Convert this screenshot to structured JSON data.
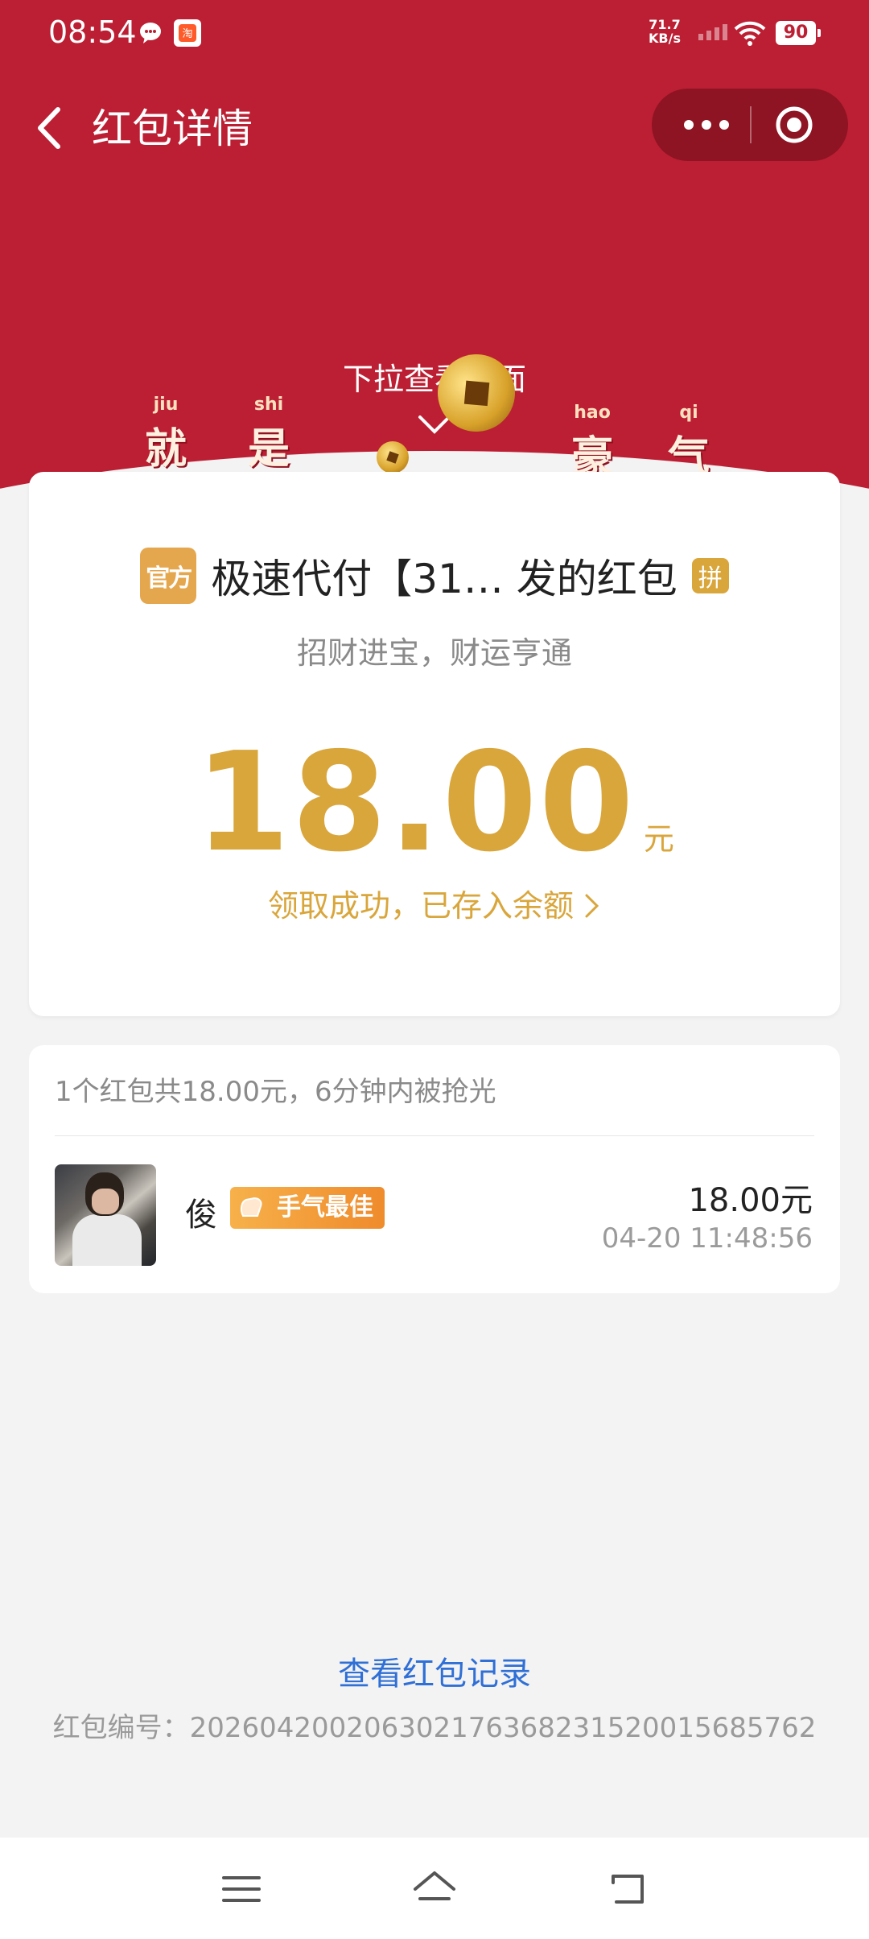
{
  "status_bar": {
    "time": "08:54",
    "net_speed_value": "71.7",
    "net_speed_unit": "KB/s",
    "battery": "90",
    "icons": [
      "chat-bubble-icon",
      "taobao-app-icon",
      "signal-icon",
      "wifi-icon",
      "battery-icon"
    ]
  },
  "nav": {
    "title": "红包详情",
    "back_icon": "chevron-left-icon",
    "more_icon": "more-dots-icon",
    "close_icon": "target-close-icon"
  },
  "cover": {
    "pull_hint": "下拉查看封面",
    "characters": [
      {
        "pinyin": "jiu",
        "hanzi": "就"
      },
      {
        "pinyin": "shi",
        "hanzi": "是"
      },
      {
        "pinyin": "hao",
        "hanzi": "豪"
      },
      {
        "pinyin": "qi",
        "hanzi": "气"
      }
    ]
  },
  "packet": {
    "official_badge": "官方",
    "sender": "极速代付【31… 发的红包",
    "pin_badge": "拼",
    "greeting": "招财进宝，财运亨通",
    "amount": "18.00",
    "unit": "元",
    "claim_status": "领取成功，已存入余额",
    "claim_chevron": "›"
  },
  "list": {
    "summary": "1个红包共18.00元，6分钟内被抢光",
    "items": [
      {
        "name": "俊",
        "badge": "手气最佳",
        "amount": "18.00元",
        "time": "04-20 11:48:56"
      }
    ]
  },
  "footer": {
    "record_link": "查看红包记录",
    "serial": "红包编号：20260420020630217636823152001568576​2"
  },
  "system_nav": {
    "icons": [
      "menu-icon",
      "home-icon",
      "back-icon"
    ]
  },
  "colors": {
    "header_red": "#bc1f33",
    "gold": "#d9a63c",
    "link_blue": "#2f6fd6"
  }
}
